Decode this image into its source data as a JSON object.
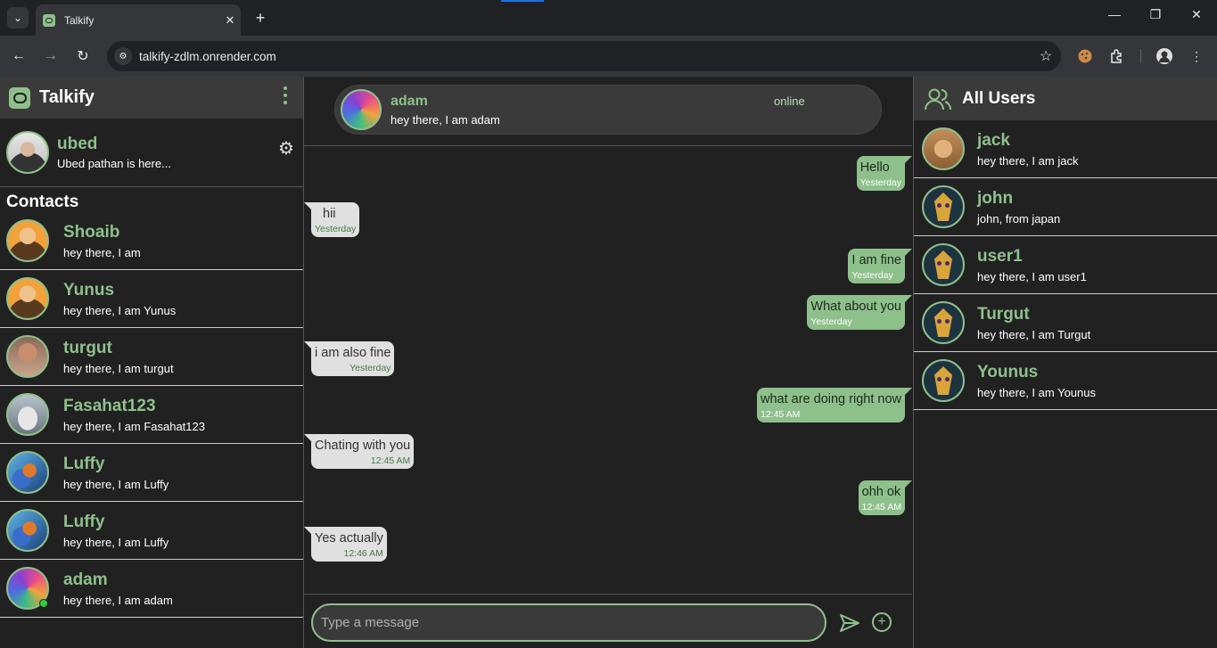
{
  "browser": {
    "tab_title": "Talkify",
    "url": "talkify-zdlm.onrender.com"
  },
  "app": {
    "title": "Talkify",
    "me": {
      "name": "ubed",
      "status": "Ubed pathan is here..."
    },
    "contacts_title": "Contacts",
    "contacts": [
      {
        "name": "Shoaib",
        "status": "hey there, I am"
      },
      {
        "name": "Yunus",
        "status": "hey there, I am Yunus"
      },
      {
        "name": "turgut",
        "status": "hey there, I am turgut"
      },
      {
        "name": "Fasahat123",
        "status": "hey there, I am Fasahat123"
      },
      {
        "name": "Luffy",
        "status": "hey there, I am Luffy"
      },
      {
        "name": "Luffy",
        "status": "hey there, I am Luffy"
      },
      {
        "name": "adam",
        "status": "hey there, I am adam"
      }
    ],
    "chat": {
      "name": "adam",
      "bio": "hey there, I am adam",
      "status": "online",
      "messages": [
        {
          "text": "Hello",
          "time": "Yesterday"
        },
        {
          "text": "hii",
          "time": "Yesterday"
        },
        {
          "text": "I am fine",
          "time": "Yesterday"
        },
        {
          "text": "What about you",
          "time": "Yesterday"
        },
        {
          "text": "i am also fine",
          "time": "Yesterday"
        },
        {
          "text": "what are doing right now",
          "time": "12:45 AM"
        },
        {
          "text": "Chating with you",
          "time": "12:45 AM"
        },
        {
          "text": "ohh ok",
          "time": "12:45 AM"
        },
        {
          "text": "Yes actually",
          "time": "12:46 AM"
        }
      ],
      "input_placeholder": "Type a message"
    },
    "all_users_title": "All Users",
    "users": [
      {
        "name": "jack",
        "status": "hey there, I am jack"
      },
      {
        "name": "john",
        "status": "john, from japan"
      },
      {
        "name": "user1",
        "status": "hey there, I am user1"
      },
      {
        "name": "Turgut",
        "status": "hey there, I am Turgut"
      },
      {
        "name": "Younus",
        "status": "hey there, I am Younus"
      }
    ]
  },
  "colors": {
    "accent": "#8ec08b",
    "panel": "#212121",
    "header": "#3a3a3a",
    "incoming": "#e0e0e0"
  }
}
